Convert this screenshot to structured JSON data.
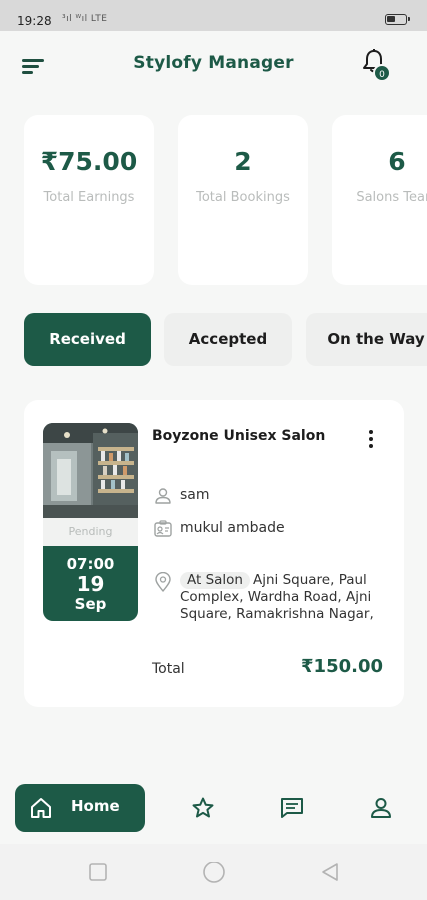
{
  "status_bar": {
    "time": "19:28",
    "signal": "³ıl ᵂıl LTE"
  },
  "header": {
    "title": "Stylofy Manager",
    "notification_count": "0"
  },
  "stats": [
    {
      "value": "₹75.00",
      "label": "Total Earnings"
    },
    {
      "value": "2",
      "label": "Total Bookings"
    },
    {
      "value": "6",
      "label": "Salons Team"
    }
  ],
  "tabs": [
    {
      "label": "Received",
      "active": true
    },
    {
      "label": "Accepted",
      "active": false
    },
    {
      "label": "On the Way",
      "active": false
    }
  ],
  "booking": {
    "salon_name": "Boyzone Unisex Salon",
    "status": "Pending",
    "time": "07:00",
    "day": "19",
    "month": "Sep",
    "customer": "sam",
    "staff": "mukul ambade",
    "location_type": "At Salon",
    "address": "Ajni Square, Paul Complex, Wardha Road, Ajni Square, Ramakrishna Nagar,",
    "total_label": "Total",
    "total_value": "₹150.00"
  },
  "bottom_nav": {
    "home_label": "Home"
  },
  "colors": {
    "primary": "#1d5a47",
    "background": "#f6f7f6",
    "muted": "#b9bcbb"
  },
  "icons": [
    "menu-icon",
    "bell-icon",
    "more-vertical-icon",
    "user-icon",
    "id-card-icon",
    "location-pin-icon",
    "home-icon",
    "star-icon",
    "chat-icon",
    "profile-icon"
  ]
}
